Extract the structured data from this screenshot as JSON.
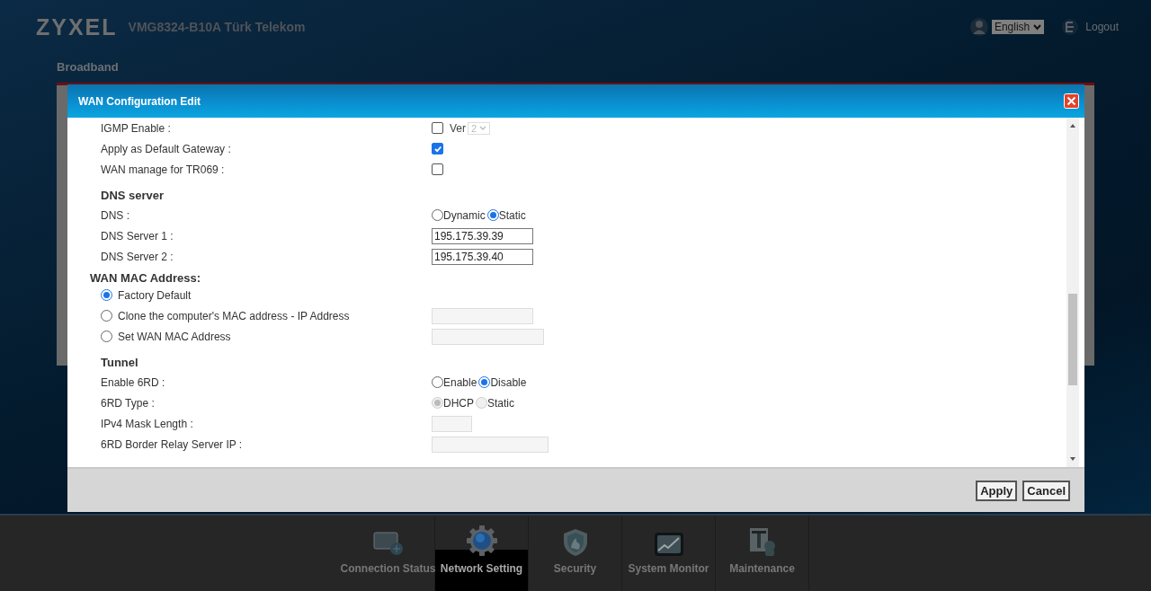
{
  "header": {
    "logo": "ZYXEL",
    "model": "VMG8324-B10A Türk Telekom",
    "language": "English",
    "logout": "Logout"
  },
  "page_title": "Broadband",
  "dialog": {
    "title": "WAN Configuration Edit",
    "sections": [
      {
        "rows": [
          {
            "kind": "checkbox_select",
            "label": "IGMP Enable :",
            "checked": false,
            "suffix": "Ver",
            "select": "2",
            "disabled": true
          },
          {
            "kind": "checkbox",
            "label": "Apply as Default Gateway :",
            "checked": true
          },
          {
            "kind": "checkbox",
            "label": "WAN manage for TR069 :",
            "checked": false
          }
        ]
      },
      {
        "kind": "minor",
        "heading": "DNS server",
        "rows": [
          {
            "kind": "radio_group",
            "label": "DNS :",
            "options": [
              {
                "label": "Dynamic",
                "selected": false,
                "disabled": false
              },
              {
                "label": "Static",
                "selected": true,
                "disabled": false
              }
            ]
          },
          {
            "kind": "input",
            "label": "DNS Server 1 :",
            "value": "195.175.39.39",
            "disabled": false
          },
          {
            "kind": "input",
            "label": "DNS Server 2 :",
            "value": "195.175.39.40",
            "disabled": false
          }
        ]
      },
      {
        "kind": "major",
        "heading": "WAN MAC Address:",
        "rows": [
          {
            "kind": "radio_line",
            "label": "Factory Default",
            "selected": true
          },
          {
            "kind": "radio_line",
            "label": "Clone the computer's MAC address - IP Address",
            "selected": false,
            "field": {
              "disabled": true
            }
          },
          {
            "kind": "radio_line",
            "label": "Set WAN MAC Address",
            "selected": false,
            "field": {
              "disabled": true
            }
          }
        ]
      },
      {
        "kind": "minor",
        "heading": "Tunnel",
        "rows": [
          {
            "kind": "radio_group",
            "label": "Enable 6RD :",
            "options": [
              {
                "label": "Enable",
                "selected": false,
                "disabled": false
              },
              {
                "label": "Disable",
                "selected": true,
                "disabled": false
              }
            ]
          },
          {
            "kind": "radio_group",
            "label": "6RD Type :",
            "options": [
              {
                "label": "DHCP",
                "selected": true,
                "disabled": true
              },
              {
                "label": "Static",
                "selected": false,
                "disabled": true
              }
            ]
          },
          {
            "kind": "input",
            "label": "IPv4 Mask Length :",
            "disabled": true
          },
          {
            "kind": "input",
            "label": "6RD Border Relay Server IP :",
            "disabled": true
          }
        ]
      }
    ],
    "buttons": [
      "Apply",
      "Cancel"
    ]
  },
  "nav": [
    {
      "label": "Connection Status",
      "selected": false
    },
    {
      "label": "Network Setting",
      "selected": true
    },
    {
      "label": "Security",
      "selected": false
    },
    {
      "label": "System Monitor",
      "selected": false
    },
    {
      "label": "Maintenance",
      "selected": false
    }
  ]
}
